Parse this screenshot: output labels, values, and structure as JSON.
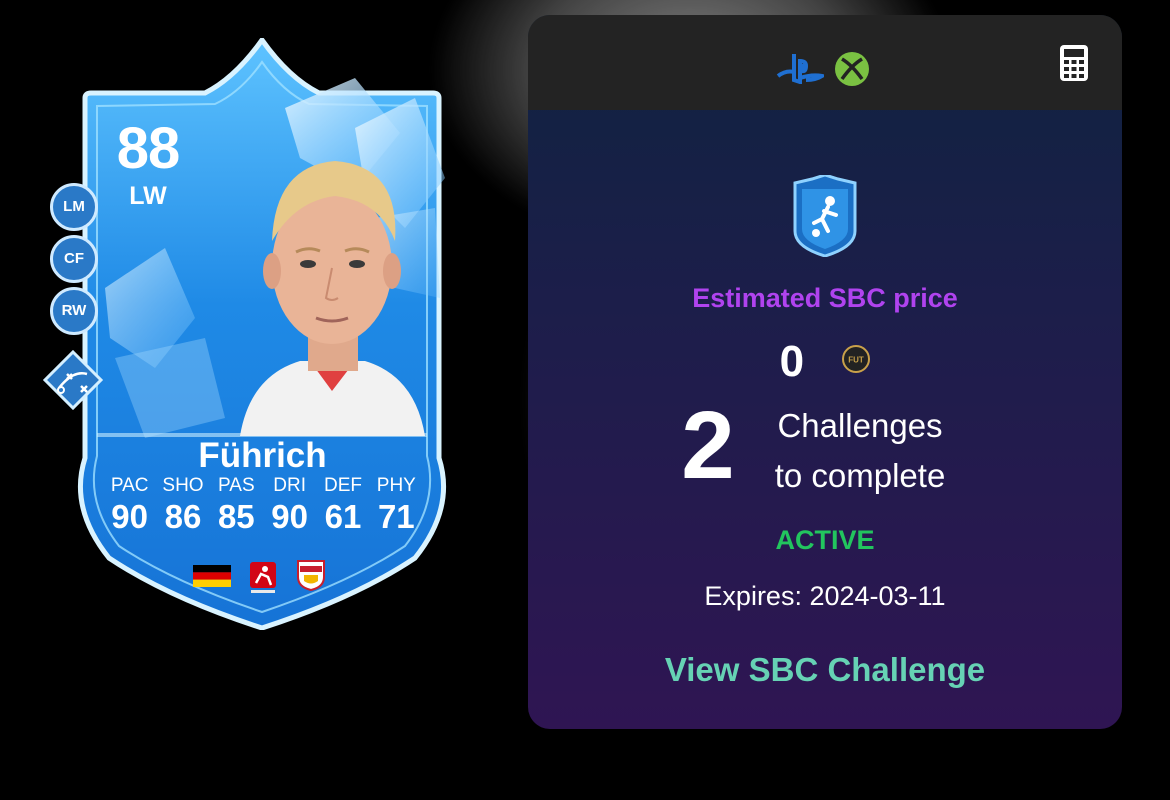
{
  "card": {
    "rating": "88",
    "position": "LW",
    "alt_positions": [
      "LM",
      "CF",
      "RW"
    ],
    "playstyle_icon": "playmaker-icon",
    "name": "Führich",
    "stats": {
      "labels": [
        "PAC",
        "SHO",
        "PAS",
        "DRI",
        "DEF",
        "PHY"
      ],
      "values": [
        "90",
        "86",
        "85",
        "90",
        "61",
        "71"
      ]
    },
    "nation_icon": "germany-flag-icon",
    "league_icon": "bundesliga-icon",
    "club_icon": "vfb-stuttgart-crest-icon",
    "colors": {
      "card_blue": "#2a8ee6",
      "frame": "#bfe9ff"
    }
  },
  "panel": {
    "platform_icons": [
      "playstation-icon",
      "xbox-icon"
    ],
    "calculator_icon": "calculator-icon",
    "sbc_badge_icon": "sbc-badge-icon",
    "estimate_label": "Estimated SBC price",
    "price": "0",
    "coin_icon": "fut-coin-icon",
    "coin_label": "FUT",
    "challenges_count": "2",
    "challenges_line1": "Challenges",
    "challenges_line2": "to complete",
    "status": "ACTIVE",
    "expires": "Expires: 2024-03-11",
    "view_link": "View SBC Challenge",
    "colors": {
      "estimate": "#b043ef",
      "active": "#22c55e",
      "link": "#66d2b4",
      "header": "#232323"
    }
  }
}
